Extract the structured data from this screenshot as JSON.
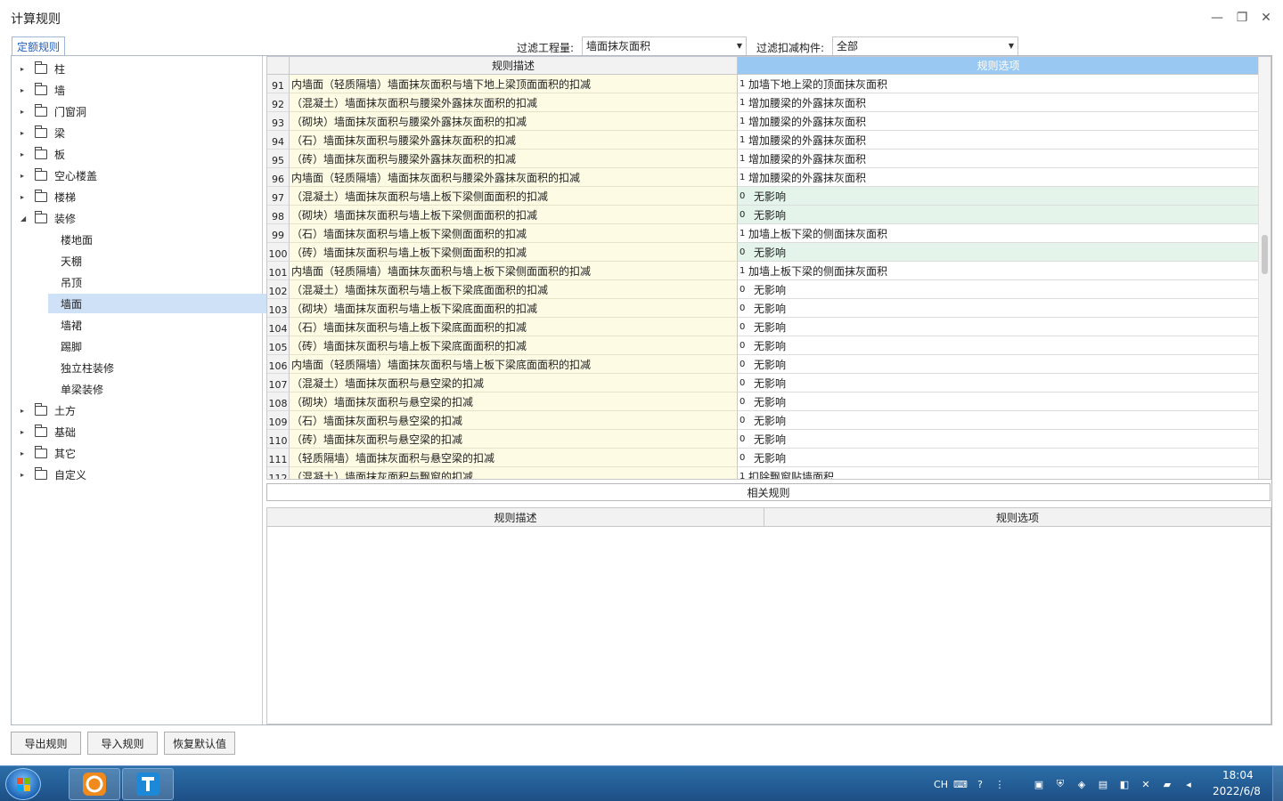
{
  "window": {
    "title": "计算规则",
    "minimize": "—",
    "restore": "❐",
    "close": "✕"
  },
  "tabs": [
    {
      "label": "定额规则",
      "active": true
    }
  ],
  "filters": {
    "project_label": "过滤工程量:",
    "project_value": "墙面抹灰面积",
    "member_label": "过滤扣减构件:",
    "member_value": "全部"
  },
  "tree": {
    "top": [
      {
        "label": "柱"
      },
      {
        "label": "墙"
      },
      {
        "label": "门窗洞"
      },
      {
        "label": "梁"
      },
      {
        "label": "板"
      },
      {
        "label": "空心楼盖"
      },
      {
        "label": "楼梯"
      },
      {
        "label": "装修",
        "expanded": true
      }
    ],
    "children": [
      {
        "label": "楼地面"
      },
      {
        "label": "天棚"
      },
      {
        "label": "吊顶"
      },
      {
        "label": "墙面",
        "selected": true
      },
      {
        "label": "墙裙"
      },
      {
        "label": "踢脚"
      },
      {
        "label": "独立柱装修"
      },
      {
        "label": "单梁装修"
      }
    ],
    "bottom": [
      {
        "label": "土方"
      },
      {
        "label": "基础"
      },
      {
        "label": "其它"
      },
      {
        "label": "自定义"
      }
    ]
  },
  "grid": {
    "headers": {
      "desc": "规则描述",
      "option": "规则选项"
    },
    "rows": [
      {
        "num": "91",
        "desc": "内墙面（轻质隔墙）墙面抹灰面积与墙下地上梁顶面面积的扣减",
        "code": "1",
        "option": "加墙下地上梁的顶面抹灰面积",
        "green": false
      },
      {
        "num": "92",
        "desc": "（混凝土）墙面抹灰面积与腰梁外露抹灰面积的扣减",
        "code": "1",
        "option": "增加腰梁的外露抹灰面积",
        "green": false
      },
      {
        "num": "93",
        "desc": "（砌块）墙面抹灰面积与腰梁外露抹灰面积的扣减",
        "code": "1",
        "option": "增加腰梁的外露抹灰面积",
        "green": false
      },
      {
        "num": "94",
        "desc": "（石）墙面抹灰面积与腰梁外露抹灰面积的扣减",
        "code": "1",
        "option": "增加腰梁的外露抹灰面积",
        "green": false
      },
      {
        "num": "95",
        "desc": "（砖）墙面抹灰面积与腰梁外露抹灰面积的扣减",
        "code": "1",
        "option": "增加腰梁的外露抹灰面积",
        "green": false
      },
      {
        "num": "96",
        "desc": "内墙面（轻质隔墙）墙面抹灰面积与腰梁外露抹灰面积的扣减",
        "code": "1",
        "option": "增加腰梁的外露抹灰面积",
        "green": false
      },
      {
        "num": "97",
        "desc": "（混凝土）墙面抹灰面积与墙上板下梁侧面面积的扣减",
        "code": "0",
        "option": "无影响",
        "green": true
      },
      {
        "num": "98",
        "desc": "（砌块）墙面抹灰面积与墙上板下梁侧面面积的扣减",
        "code": "0",
        "option": "无影响",
        "green": true
      },
      {
        "num": "99",
        "desc": "（石）墙面抹灰面积与墙上板下梁侧面面积的扣减",
        "code": "1",
        "option": "加墙上板下梁的侧面抹灰面积",
        "green": false
      },
      {
        "num": "100",
        "desc": "（砖）墙面抹灰面积与墙上板下梁侧面面积的扣减",
        "code": "0",
        "option": "无影响",
        "green": true
      },
      {
        "num": "101",
        "desc": "内墙面（轻质隔墙）墙面抹灰面积与墙上板下梁侧面面积的扣减",
        "code": "1",
        "option": "加墙上板下梁的侧面抹灰面积",
        "green": false
      },
      {
        "num": "102",
        "desc": "（混凝土）墙面抹灰面积与墙上板下梁底面面积的扣减",
        "code": "0",
        "option": "无影响",
        "green": false
      },
      {
        "num": "103",
        "desc": "（砌块）墙面抹灰面积与墙上板下梁底面面积的扣减",
        "code": "0",
        "option": "无影响",
        "green": false
      },
      {
        "num": "104",
        "desc": "（石）墙面抹灰面积与墙上板下梁底面面积的扣减",
        "code": "0",
        "option": "无影响",
        "green": false
      },
      {
        "num": "105",
        "desc": "（砖）墙面抹灰面积与墙上板下梁底面面积的扣减",
        "code": "0",
        "option": "无影响",
        "green": false
      },
      {
        "num": "106",
        "desc": "内墙面（轻质隔墙）墙面抹灰面积与墙上板下梁底面面积的扣减",
        "code": "0",
        "option": "无影响",
        "green": false
      },
      {
        "num": "107",
        "desc": "（混凝土）墙面抹灰面积与悬空梁的扣减",
        "code": "0",
        "option": "无影响",
        "green": false
      },
      {
        "num": "108",
        "desc": "（砌块）墙面抹灰面积与悬空梁的扣减",
        "code": "0",
        "option": "无影响",
        "green": false
      },
      {
        "num": "109",
        "desc": "（石）墙面抹灰面积与悬空梁的扣减",
        "code": "0",
        "option": "无影响",
        "green": false
      },
      {
        "num": "110",
        "desc": "（砖）墙面抹灰面积与悬空梁的扣减",
        "code": "0",
        "option": "无影响",
        "green": false
      },
      {
        "num": "111",
        "desc": "（轻质隔墙）墙面抹灰面积与悬空梁的扣减",
        "code": "0",
        "option": "无影响",
        "green": false
      },
      {
        "num": "112",
        "desc": "（混凝土）墙面抹灰面积与飘窗的扣减",
        "code": "1",
        "option": "扣除飘窗贴墙面积",
        "green": false
      }
    ]
  },
  "related": {
    "bar_label": "相关规则",
    "headers": {
      "desc": "规则描述",
      "option": "规则选项"
    }
  },
  "buttons": {
    "export": "导出规则",
    "import": "导入规则",
    "restore": "恢复默认值"
  },
  "taskbar": {
    "lang": "CH",
    "time": "18:04",
    "date": "2022/6/8"
  }
}
